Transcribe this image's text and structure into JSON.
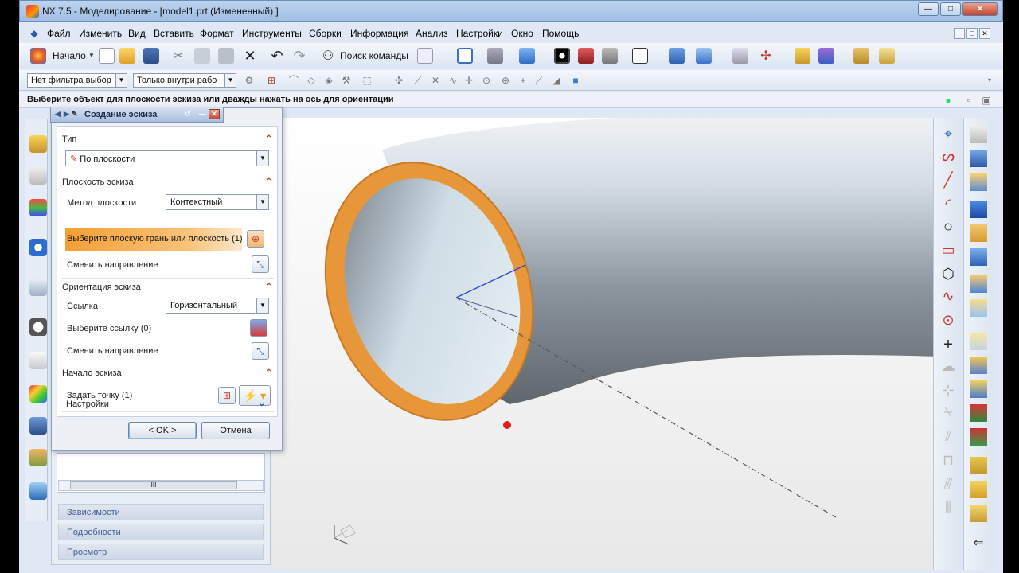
{
  "window": {
    "title": "NX 7.5 - Моделирование - [model1.prt (Измененный) ]",
    "controls": {
      "minimize": "—",
      "maximize": "□",
      "close": "✕"
    }
  },
  "menubar": {
    "items": [
      "Файл",
      "Изменить",
      "Вид",
      "Вставить",
      "Формат",
      "Инструменты",
      "Сборки",
      "Информация",
      "Анализ",
      "Настройки",
      "Окно",
      "Помощь"
    ],
    "mdi": [
      "_",
      "□",
      "✕"
    ]
  },
  "toolbar1": {
    "start_label": "Начало",
    "find_command_label": "Поиск команды"
  },
  "toolbar2": {
    "filter_type": "Нет фильтра выбор",
    "filter_scope": "Только внутри рабо"
  },
  "cue": {
    "text": "Выберите объект для плоскости эскиза или дважды нажать на ось для ориентации"
  },
  "dialog": {
    "title": "Создание эскиза",
    "type_group": "Тип",
    "type_value": "По плоскости",
    "plane_group": "Плоскость эскиза",
    "plane_method_label": "Метод плоскости",
    "plane_method_value": "Контекстный",
    "select_face_label": "Выберите плоскую грань или плоскость (1)",
    "reverse_dir_label_1": "Сменить направление",
    "orientation_group": "Ориентация эскиза",
    "reference_label": "Ссылка",
    "reference_value": "Горизонтальный",
    "select_reference_label": "Выберите ссылку (0)",
    "reverse_dir_label_2": "Сменить направление",
    "origin_group": "Начало эскиза",
    "specify_point_label": "Задать точку (1)",
    "settings_group": "Настройки",
    "ok_label": "< OK >",
    "cancel_label": "Отмена"
  },
  "navigator": {
    "scroll_thumb": "III",
    "sections": [
      "Зависимости",
      "Подробности",
      "Просмотр"
    ]
  },
  "colors": {
    "selection_orange": "#e8963a",
    "face_highlight": "#f5a54a",
    "title_blue": "#a9c2e3"
  }
}
